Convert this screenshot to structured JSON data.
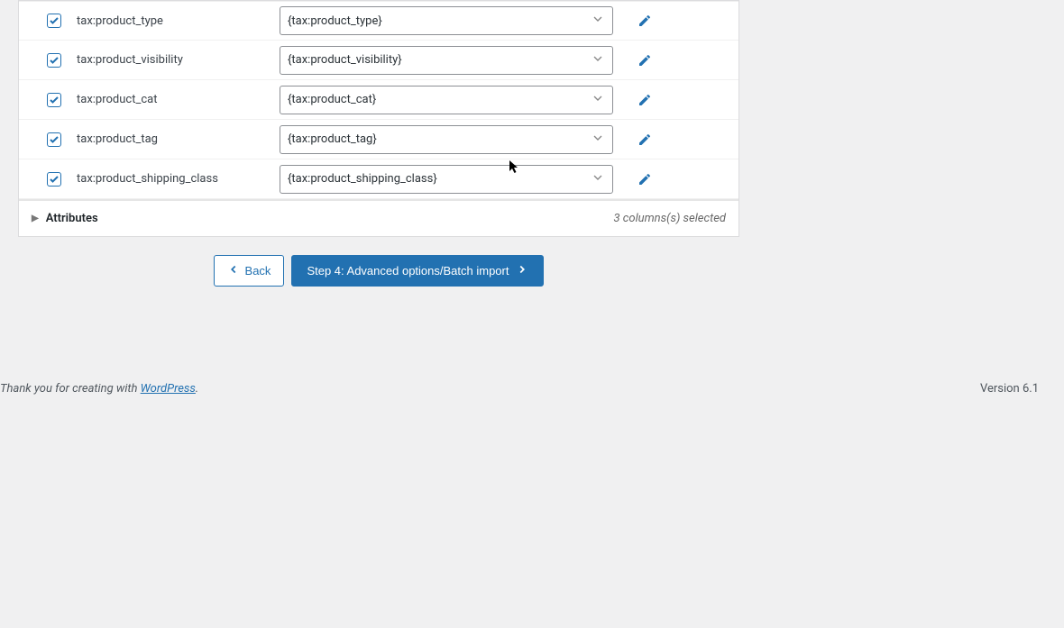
{
  "rows": [
    {
      "label": "tax:product_type",
      "value": "{tax:product_type}"
    },
    {
      "label": "tax:product_visibility",
      "value": "{tax:product_visibility}"
    },
    {
      "label": "tax:product_cat",
      "value": "{tax:product_cat}"
    },
    {
      "label": "tax:product_tag",
      "value": "{tax:product_tag}"
    },
    {
      "label": "tax:product_shipping_class",
      "value": "{tax:product_shipping_class}"
    }
  ],
  "subsection": {
    "title": "Attributes",
    "summary": "3 columns(s) selected"
  },
  "buttons": {
    "back": "Back",
    "next": "Step 4: Advanced options/Batch import"
  },
  "footer": {
    "prefix": "Thank you for creating with ",
    "link": "WordPress",
    "suffix": ".",
    "version": "Version 6.1"
  }
}
